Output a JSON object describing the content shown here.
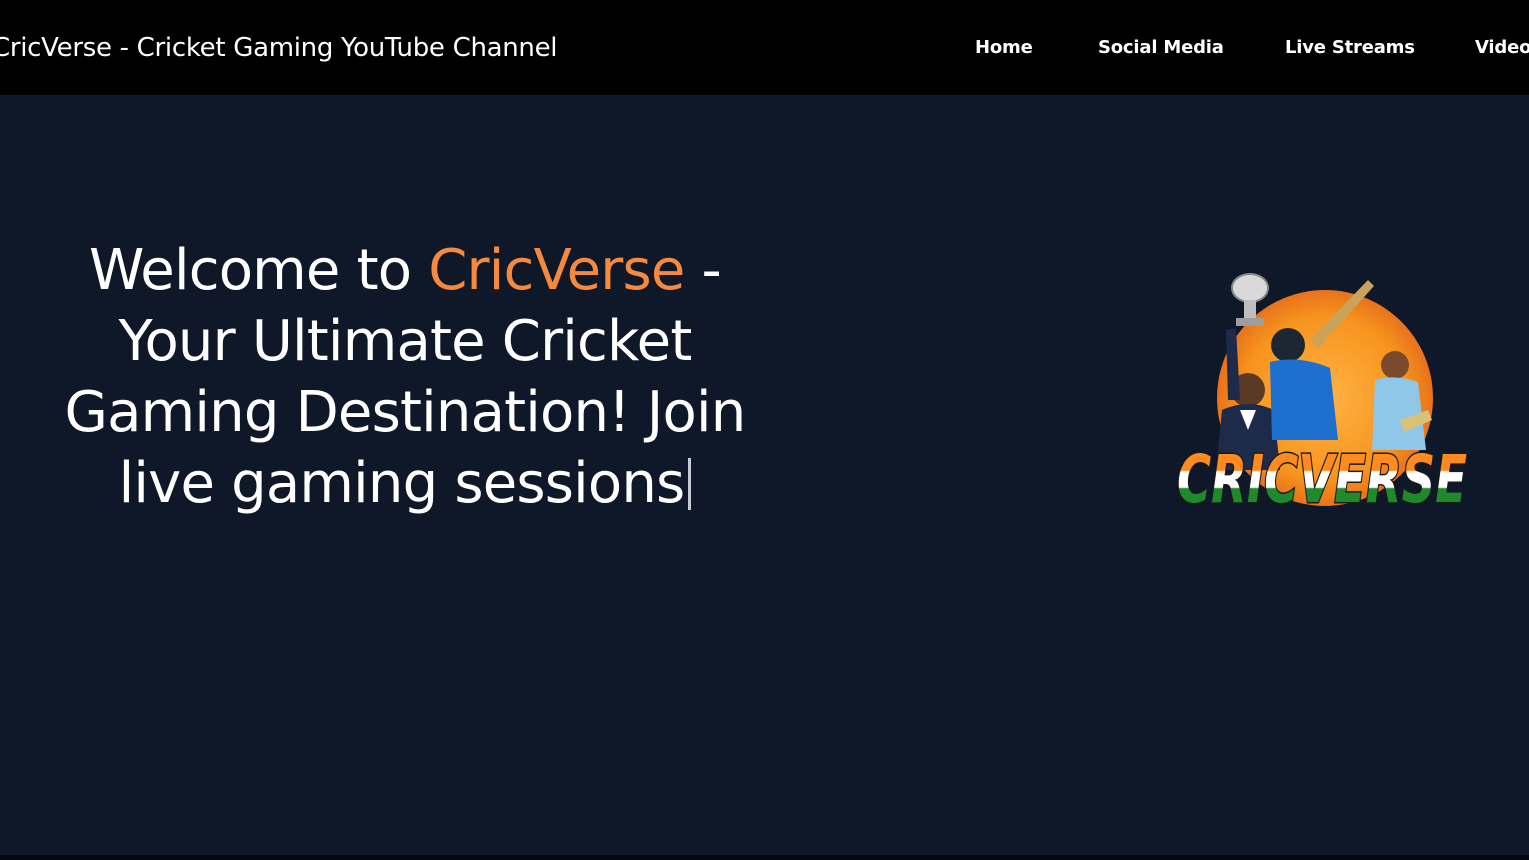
{
  "header": {
    "site_title": "CricVerse - Cricket Gaming YouTube Channel",
    "nav": [
      {
        "label": "Home"
      },
      {
        "label": "Social Media"
      },
      {
        "label": "Live Streams"
      },
      {
        "label": "Videos"
      }
    ]
  },
  "hero": {
    "text_before": "Welcome to ",
    "highlight": "CricVerse",
    "text_after": " - Your Ultimate Cricket Gaming Destination! Join live gaming sessions",
    "logo_text": "CRICVERSE"
  },
  "colors": {
    "header_bg": "#000000",
    "page_bg": "#0e1829",
    "accent": "#f58a3f",
    "text": "#ffffff"
  }
}
